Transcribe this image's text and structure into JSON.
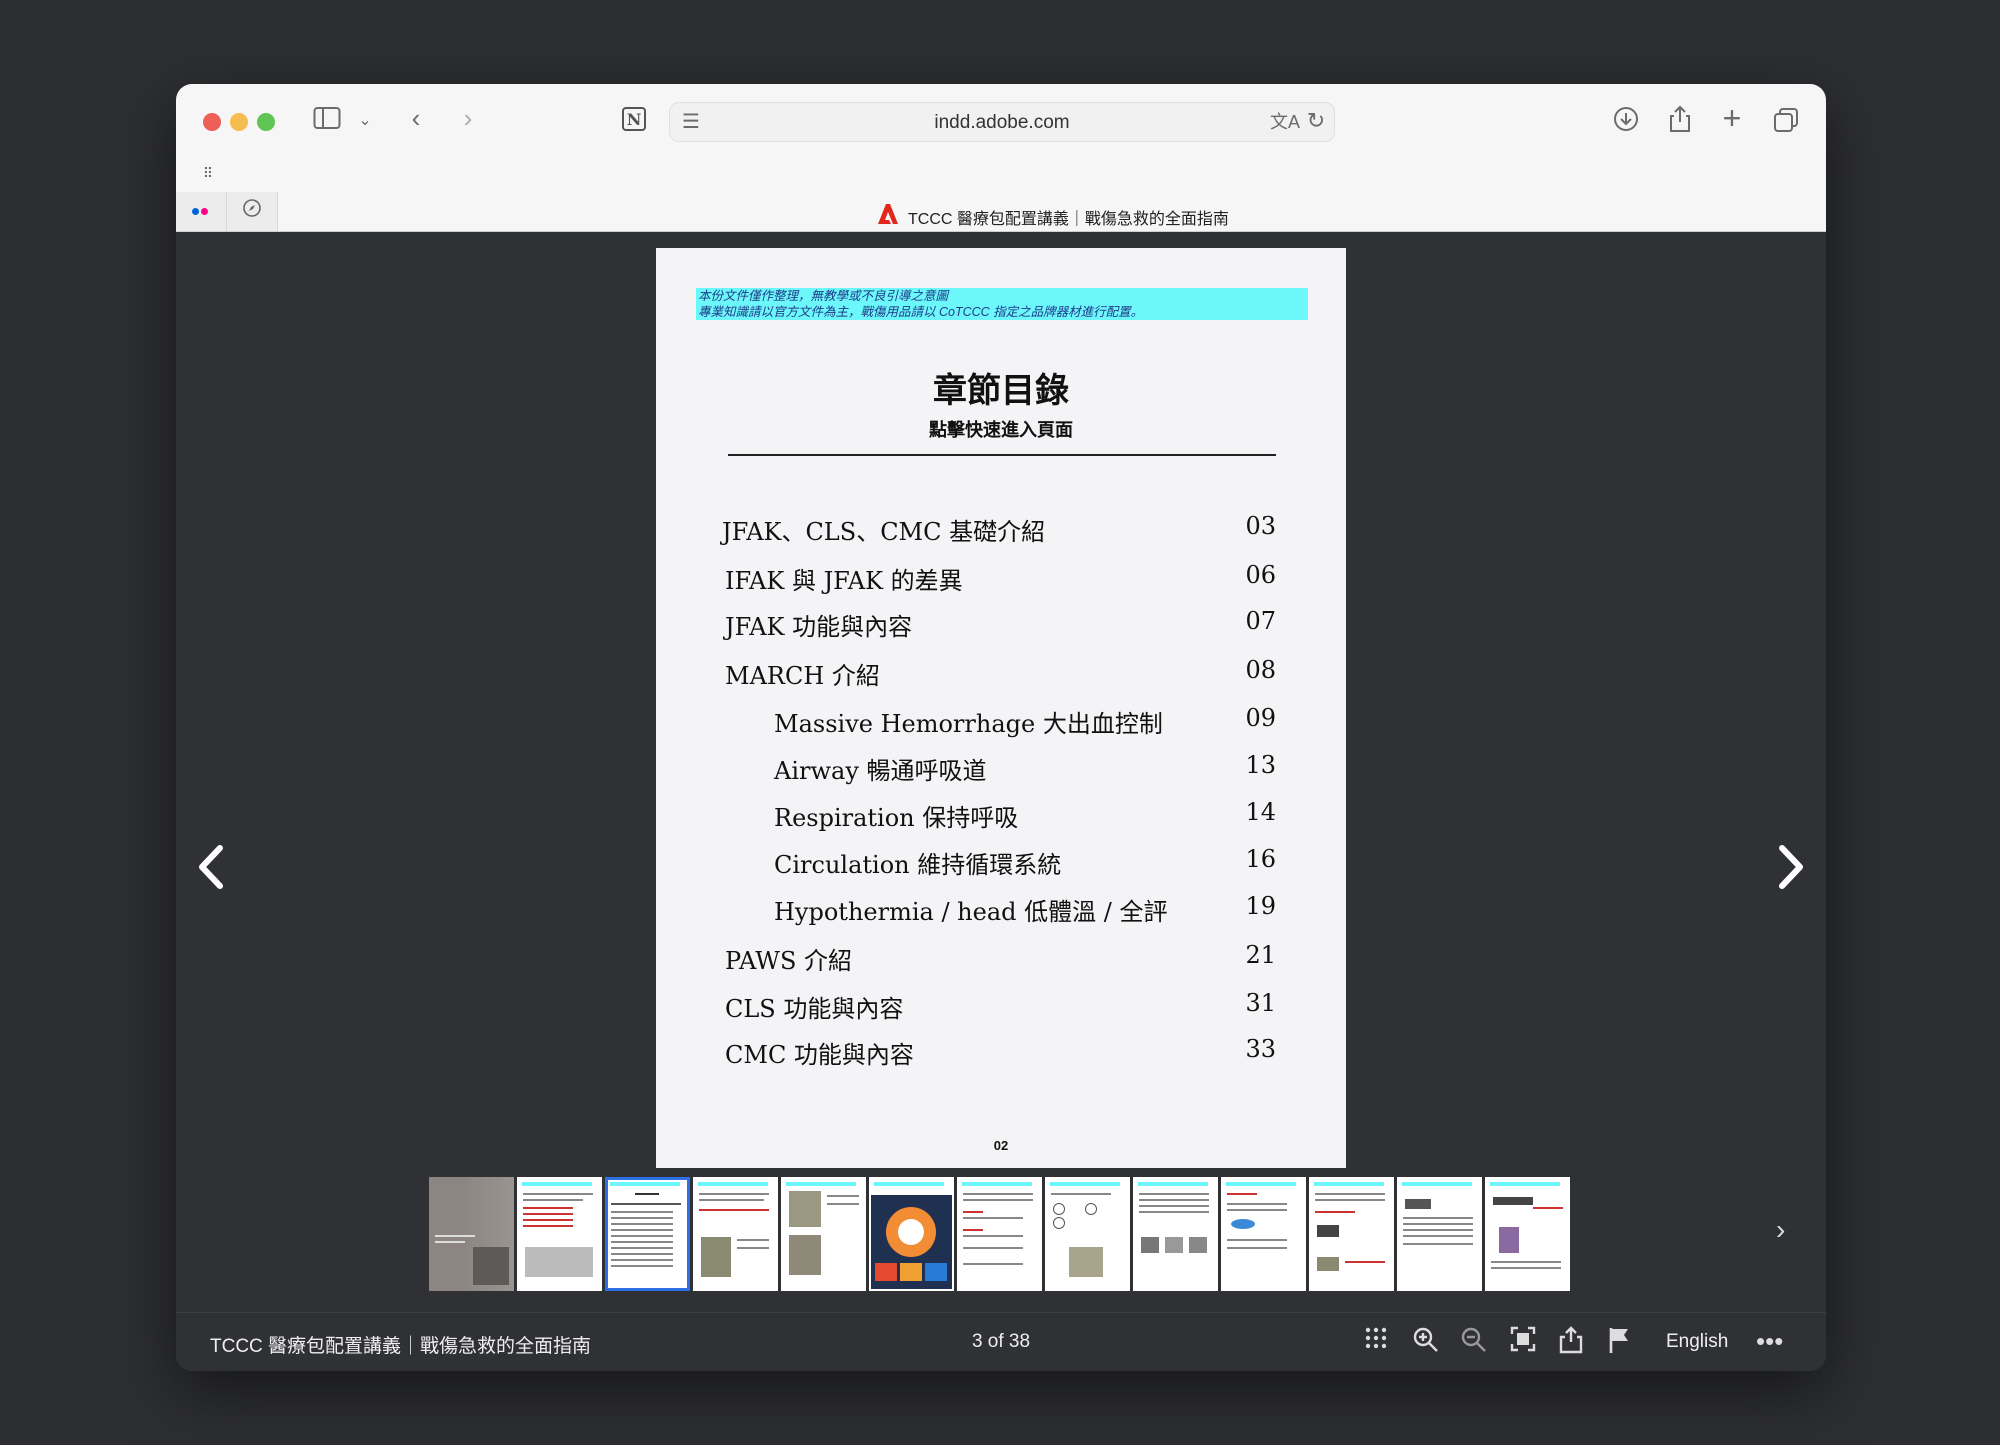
{
  "browser": {
    "url": "indd.adobe.com",
    "tab_title": "TCCC 醫療包配置講義｜戰傷急救的全面指南",
    "icons": [
      "sidebar-icon",
      "chevron-down-icon",
      "back-icon",
      "forward-icon",
      "notion-icon",
      "reader-icon",
      "translate-icon",
      "reload-icon",
      "download-icon",
      "share-icon",
      "new-tab-icon",
      "tabs-overview-icon",
      "grid-icon",
      "compass-icon"
    ]
  },
  "document": {
    "note_line1": "本份文件僅作整理，無教學或不良引導之意圖",
    "note_line2": "專業知識請以官方文件為主，戰傷用品請以 CoTCCC 指定之品牌器材進行配置。",
    "title": "章節目錄",
    "subtitle": "點擊快速進入頁面",
    "toc": [
      {
        "label": "JFAK、CLS、CMC 基礎介紹",
        "page": "03"
      },
      {
        "label": "IFAK 與 JFAK 的差異",
        "page": "06"
      },
      {
        "label": "JFAK 功能與內容",
        "page": "07"
      },
      {
        "label": "MARCH 介紹",
        "page": "08"
      },
      {
        "label": "Massive Hemorrhage 大出血控制",
        "page": "09"
      },
      {
        "label": "Airway 暢通呼吸道",
        "page": "13"
      },
      {
        "label": "Respiration 保持呼吸",
        "page": "14"
      },
      {
        "label": "Circulation 維持循環系統",
        "page": "16"
      },
      {
        "label": "Hypothermia / head 低體溫 / 全評",
        "page": "19"
      },
      {
        "label": "PAWS 介紹",
        "page": "21"
      },
      {
        "label": "CLS 功能與內容",
        "page": "31"
      },
      {
        "label": "CMC 功能與內容",
        "page": "33"
      }
    ],
    "page_number": "02"
  },
  "statusbar": {
    "title": "TCCC 醫療包配置講義｜戰傷急救的全面指南",
    "page_count": "3 of 38",
    "language": "English"
  }
}
